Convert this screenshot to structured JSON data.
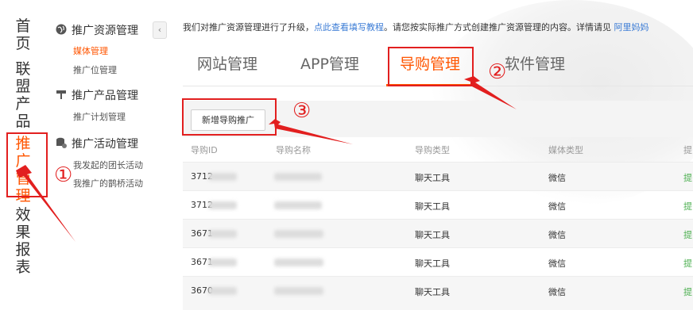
{
  "leftnav": {
    "items": [
      {
        "label": "首页",
        "active": false
      },
      {
        "label": "联盟产品",
        "active": false
      },
      {
        "label": "推广管理",
        "active": true
      },
      {
        "label": "效果报表",
        "active": false
      }
    ]
  },
  "sidebar": {
    "collapse_label": "‹",
    "groups": [
      {
        "title": "推广资源管理",
        "icon": "globe-icon",
        "items": [
          {
            "label": "媒体管理",
            "active": true
          },
          {
            "label": "推广位管理",
            "active": false
          }
        ]
      },
      {
        "title": "推广产品管理",
        "icon": "pin-icon",
        "items": [
          {
            "label": "推广计划管理",
            "active": false
          }
        ]
      },
      {
        "title": "推广活动管理",
        "icon": "activity-icon",
        "items": [
          {
            "label": "我发起的团长活动",
            "active": false
          },
          {
            "label": "我推广的鹊桥活动",
            "active": false
          }
        ]
      }
    ]
  },
  "notice": {
    "text_before": "我们对推广资源管理进行了升级，",
    "link": "点此查看填写教程",
    "text_after": "。请您按实际推广方式创建推广资源管理的内容。详情请见 ",
    "link2": "阿里妈妈"
  },
  "tabs": [
    {
      "label": "网站管理",
      "active": false
    },
    {
      "label": "APP管理",
      "active": false
    },
    {
      "label": "导购管理",
      "active": true
    },
    {
      "label": "软件管理",
      "active": false
    }
  ],
  "toolbar": {
    "add_label": "新增导购推广"
  },
  "table": {
    "columns": [
      "导购ID",
      "导购名称",
      "导购类型",
      "媒体类型",
      "提"
    ],
    "rows": [
      {
        "id": "3712",
        "type": "聊天工具",
        "media": "微信",
        "op": "提"
      },
      {
        "id": "3712",
        "type": "聊天工具",
        "media": "微信",
        "op": "提"
      },
      {
        "id": "3671",
        "type": "聊天工具",
        "media": "微信",
        "op": "提"
      },
      {
        "id": "3671",
        "type": "聊天工具",
        "media": "微信",
        "op": "提"
      },
      {
        "id": "3670",
        "type": "聊天工具",
        "media": "微信",
        "op": "提"
      }
    ]
  },
  "annotations": {
    "one": "①",
    "two": "②",
    "three": "③"
  },
  "colors": {
    "accent": "#ff5500",
    "annotation": "#e21f1f",
    "link": "#3a7bd5",
    "op": "#4caf50"
  }
}
